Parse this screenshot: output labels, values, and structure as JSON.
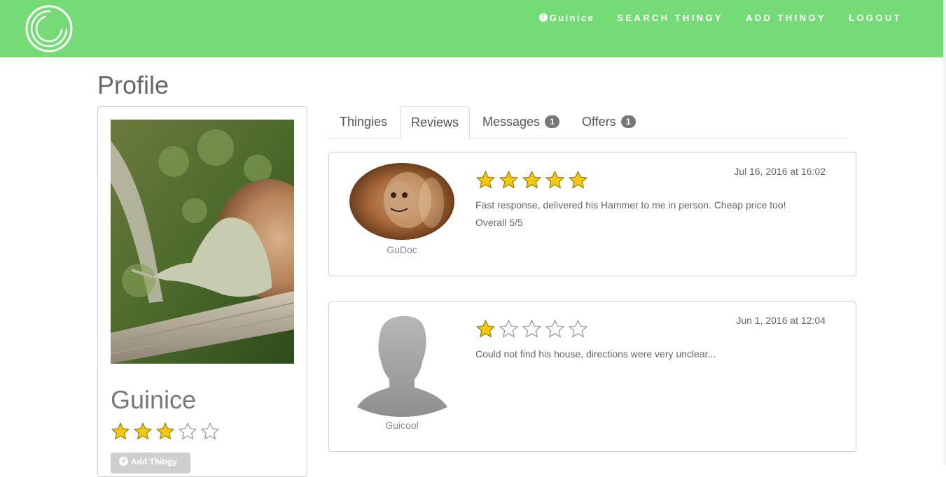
{
  "nav": {
    "user_label": "Guinice",
    "search_label": "SEARCH THINGY",
    "add_label": "ADD THINGY",
    "logout_label": "LOGOUT",
    "bar_color": "#76db77"
  },
  "page": {
    "title": "Profile"
  },
  "profile": {
    "name": "Guinice",
    "rating": 3,
    "rating_max": 5,
    "add_button_label": "Add Thingy"
  },
  "tabs": [
    {
      "label": "Thingies",
      "active": false
    },
    {
      "label": "Reviews",
      "active": true
    },
    {
      "label": "Messages",
      "badge": "1",
      "active": false
    },
    {
      "label": "Offers",
      "badge": "1",
      "active": false
    }
  ],
  "reviews": [
    {
      "reviewer": "GuDoc",
      "date": "Jul 16, 2016 at 16:02",
      "rating": 5,
      "text": "Fast response, delivered his Hammer to me in person.  Cheap price too!",
      "overall": "Overall 5/5"
    },
    {
      "reviewer": "Guicool",
      "date": "Jun 1, 2016 at 12:04",
      "rating": 1,
      "text": "Could not find his house, directions were very unclear..."
    }
  ],
  "colors": {
    "star_filled": "#f2c811",
    "star_outline": "#888888"
  }
}
